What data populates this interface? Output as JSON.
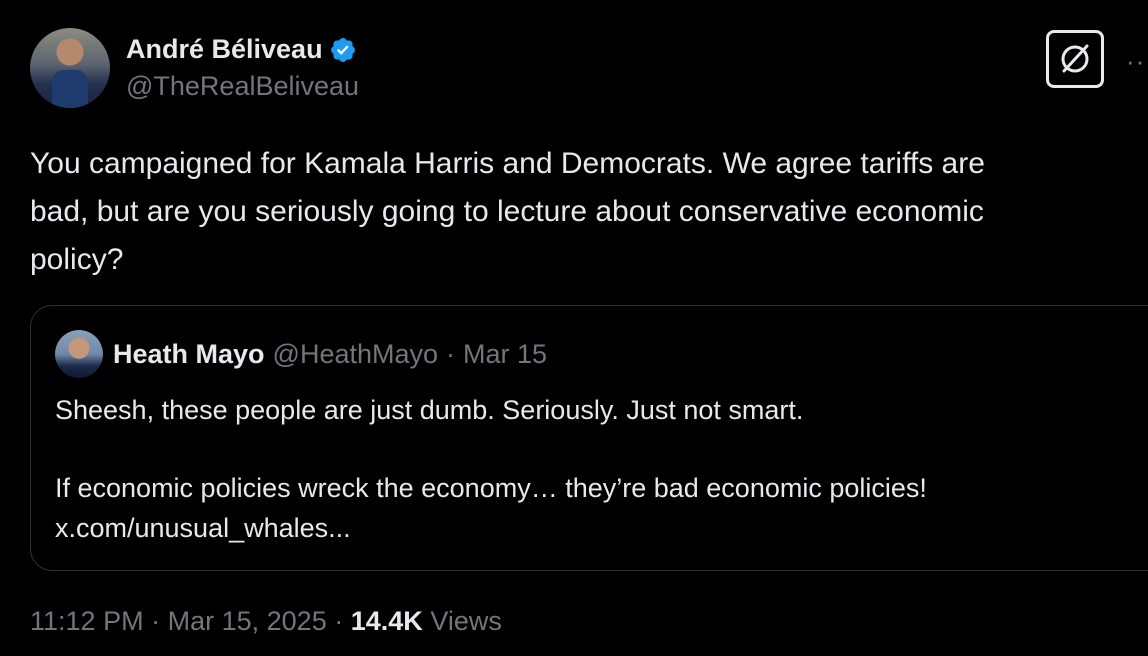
{
  "author": {
    "display_name": "André Béliveau",
    "handle": "@TheRealBeliveau",
    "verified": true,
    "verified_color": "#1d9bf0"
  },
  "tweet": {
    "text_lines": [
      "You campaigned for Kamala Harris and Democrats. We agree tariffs are",
      "bad, but are you seriously going to lecture about conservative economic",
      "policy?"
    ]
  },
  "quote": {
    "name": "Heath Mayo",
    "handle": "@HeathMayo",
    "separator": "·",
    "date": "Mar 15",
    "line1": "Sheesh, these people are just dumb. Seriously. Just not smart.",
    "line2": "If economic policies wreck the economy… they’re bad economic policies!",
    "link": "x.com/unusual_whales..."
  },
  "meta": {
    "time": "11:12 PM",
    "sep1": "·",
    "date": "Mar 15, 2025",
    "sep2": "·",
    "views_count": "14.4K",
    "views_label": "Views"
  },
  "icons": {
    "grok": "grok-icon",
    "more": "more-icon",
    "verified": "verified-badge-icon"
  },
  "colors": {
    "background": "#000000",
    "text": "#e7e9ea",
    "secondary": "#71767b",
    "border": "#2f3336"
  }
}
